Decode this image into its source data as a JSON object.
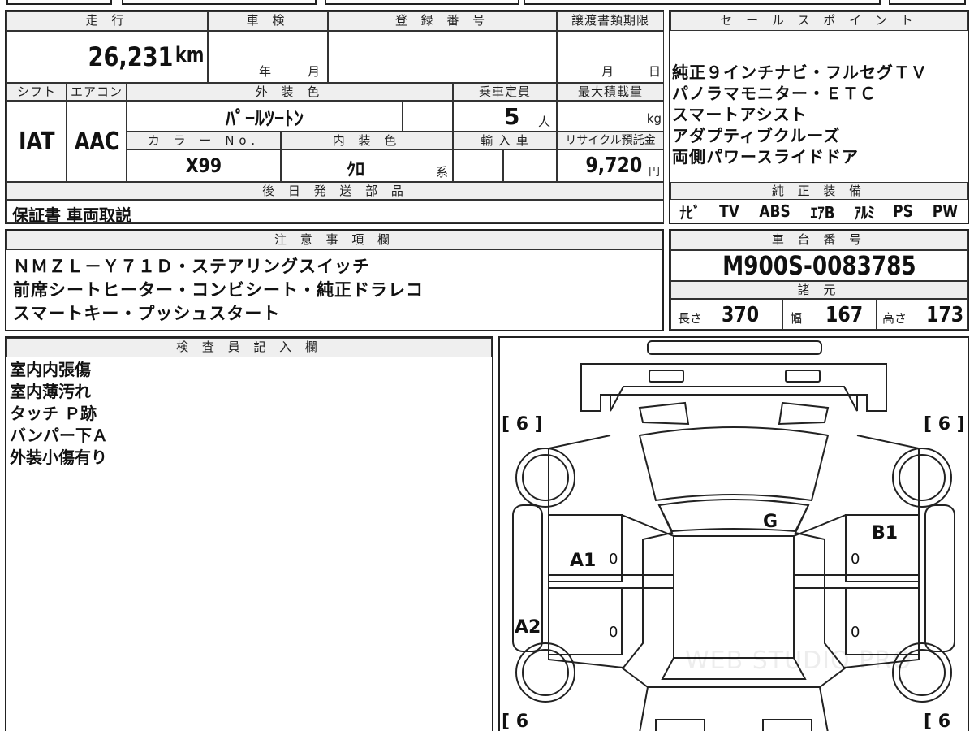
{
  "top_partial": "",
  "mileage": {
    "header": "走 行",
    "value": "26,231",
    "unit": "km"
  },
  "inspection": {
    "header": "車 検",
    "year_label": "年",
    "month_label": "月"
  },
  "registration": {
    "header": "登 録 番 号",
    "value": ""
  },
  "transfer_deadline": {
    "header": "譲渡書類期限",
    "month_label": "月",
    "day_label": "日"
  },
  "shift": {
    "header": "シフト",
    "value": "IAT"
  },
  "aircon": {
    "header": "エアコン",
    "value": "AAC"
  },
  "exterior_color": {
    "header": "外 装 色",
    "value": "ﾊﾟｰﾙﾂｰﾄﾝ"
  },
  "capacity": {
    "header": "乗車定員",
    "value": "5",
    "unit": "人"
  },
  "max_load": {
    "header": "最大積載量",
    "value": "",
    "unit": "kg"
  },
  "color_no": {
    "header": "カ ラ ー No.",
    "value": "X99"
  },
  "interior_color": {
    "header": "内 装 色",
    "value": "ｸﾛ",
    "suffix": "系"
  },
  "import": {
    "header": "輸 入 車"
  },
  "recycle": {
    "header": "リサイクル預託金",
    "value": "9,720",
    "unit": "円"
  },
  "later_parts": {
    "header": "後 日 発 送 部 品",
    "value": "保証書 車両取説"
  },
  "sales_points": {
    "header": "セ ー ル ス ポ イ ン ト",
    "lines": [
      "純正９インチナビ・フルセグＴＶ",
      "パノラマモニター・ＥＴＣ",
      "スマートアシスト",
      "アダプティブクルーズ",
      "両側パワースライドドア"
    ]
  },
  "equipment": {
    "header": "純 正 装 備",
    "items": [
      "ﾅﾋﾞ",
      "TV",
      "ABS",
      "ｴｱB",
      "ｱﾙﾐ",
      "PS",
      "PW"
    ]
  },
  "notes": {
    "header": "注 意 事 項 欄",
    "lines": [
      "ＮＭＺＬ－Ｙ７１Ｄ・ステアリングスイッチ",
      "前席シートヒーター・コンビシート・純正ドラレコ",
      "スマートキー・プッシュスタート"
    ]
  },
  "chassis": {
    "header": "車 台 番 号",
    "value": "M900S-0083785"
  },
  "specs": {
    "header": "諸 元",
    "length_label": "長さ",
    "length": "370",
    "width_label": "幅",
    "width": "167",
    "height_label": "高さ",
    "height": "173"
  },
  "inspector": {
    "header": "検 査 員 記 入 欄",
    "lines": [
      "室内内張傷",
      "室内薄汚れ",
      "タッチ Ｐ跡",
      "バンパー下Ａ",
      "外装小傷有り"
    ]
  },
  "diagram": {
    "tire_tl": "[ 6 ]",
    "tire_tr": "[ 6 ]",
    "tire_bl": "[ 6",
    "tire_br": "[ 6",
    "mark_g": "G",
    "mark_b1": "B1",
    "mark_a1": "A1",
    "mark_a2": "A2",
    "zero": "0",
    "watermark": "WEB STUDIO PRO"
  }
}
